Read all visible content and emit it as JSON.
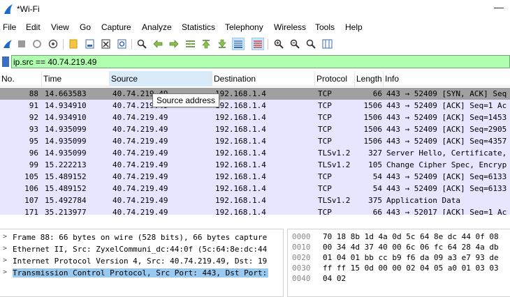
{
  "window": {
    "title": "*Wi-Fi",
    "minimize": "—"
  },
  "menu": [
    "File",
    "Edit",
    "View",
    "Go",
    "Capture",
    "Analyze",
    "Statistics",
    "Telephony",
    "Wireless",
    "Tools",
    "Help"
  ],
  "toolbar": {
    "icons": [
      "shark-fin-start-icon",
      "stop-capture-icon",
      "restart-capture-icon",
      "capture-options-icon",
      "open-file-icon",
      "save-file-icon",
      "close-file-icon",
      "reload-file-icon",
      "find-packet-icon",
      "go-back-icon",
      "go-forward-icon",
      "go-to-packet-icon",
      "first-packet-icon",
      "last-packet-icon",
      "autoscroll-icon",
      "colorize-icon",
      "zoom-in-icon",
      "zoom-out-icon",
      "normal-size-icon",
      "resize-columns-icon"
    ]
  },
  "filter": {
    "value": "ip.src == 40.74.219.49"
  },
  "packet_list": {
    "columns": [
      "No.",
      "Time",
      "Source",
      "Destination",
      "Protocol",
      "Length",
      "Info"
    ],
    "rows": [
      {
        "no": "88",
        "time": "14.663583",
        "src": "40.74.219.49",
        "dst": "192.168.1.4",
        "proto": "TCP",
        "len": "66",
        "info": "443 → 52409 [SYN, ACK] Seq",
        "selected": true
      },
      {
        "no": "91",
        "time": "14.934910",
        "src": "40.74.219.49",
        "dst": "192.168.1.4",
        "proto": "TCP",
        "len": "1506",
        "info": "443 → 52409 [ACK] Seq=1 Ac"
      },
      {
        "no": "92",
        "time": "14.934910",
        "src": "40.74.219.49",
        "dst": "192.168.1.4",
        "proto": "TCP",
        "len": "1506",
        "info": "443 → 52409 [ACK] Seq=1453"
      },
      {
        "no": "93",
        "time": "14.935099",
        "src": "40.74.219.49",
        "dst": "192.168.1.4",
        "proto": "TCP",
        "len": "1506",
        "info": "443 → 52409 [ACK] Seq=2905"
      },
      {
        "no": "95",
        "time": "14.935099",
        "src": "40.74.219.49",
        "dst": "192.168.1.4",
        "proto": "TCP",
        "len": "1506",
        "info": "443 → 52409 [ACK] Seq=4357"
      },
      {
        "no": "96",
        "time": "14.935099",
        "src": "40.74.219.49",
        "dst": "192.168.1.4",
        "proto": "TLSv1.2",
        "len": "327",
        "info": "Server Hello, Certificate,"
      },
      {
        "no": "99",
        "time": "15.222213",
        "src": "40.74.219.49",
        "dst": "192.168.1.4",
        "proto": "TLSv1.2",
        "len": "105",
        "info": "Change Cipher Spec, Encryp"
      },
      {
        "no": "105",
        "time": "15.489152",
        "src": "40.74.219.49",
        "dst": "192.168.1.4",
        "proto": "TCP",
        "len": "54",
        "info": "443 → 52409 [ACK] Seq=6133"
      },
      {
        "no": "106",
        "time": "15.489152",
        "src": "40.74.219.49",
        "dst": "192.168.1.4",
        "proto": "TCP",
        "len": "54",
        "info": "443 → 52409 [ACK] Seq=6133"
      },
      {
        "no": "107",
        "time": "15.492784",
        "src": "40.74.219.49",
        "dst": "192.168.1.4",
        "proto": "TLSv1.2",
        "len": "375",
        "info": "Application Data"
      },
      {
        "no": "171",
        "time": "35.213977",
        "src": "40.74.219.49",
        "dst": "192.168.1.4",
        "proto": "TCP",
        "len": "66",
        "info": "443 → 52017 [ACK] Seq=1 Ac"
      }
    ],
    "tooltip": "Source address"
  },
  "details": [
    {
      "text": "Frame 88: 66 bytes on wire (528 bits), 66 bytes capture"
    },
    {
      "text": "Ethernet II, Src: ZyxelCommuni_dc:44:0f (5c:64:8e:dc:44"
    },
    {
      "text": "Internet Protocol Version 4, Src: 40.74.219.49, Dst: 19"
    },
    {
      "text": "Transmission Control Protocol, Src Port: 443, Dst Port:",
      "selected": true
    }
  ],
  "bytes": [
    {
      "offset": "0000",
      "hex": "70 18 8b 1d 4a 0d 5c 64  8e dc 44 0f 08"
    },
    {
      "offset": "0010",
      "hex": "00 34 4d 37 40 00 6c 06  fc 64 28 4a db"
    },
    {
      "offset": "0020",
      "hex": "01 04 01 bb cc b9 f6 da  09 a3 e7 93 de"
    },
    {
      "offset": "0030",
      "hex": "ff ff 15 0d 00 00 02 04  05 a0 01 03 03"
    },
    {
      "offset": "0040",
      "hex": "04 02"
    }
  ],
  "colors": {
    "filter_valid": "#afffaf",
    "row_tcp": "#e7e6ff",
    "row_selected": "#a0a0a0",
    "detail_selected": "#99c9ef"
  }
}
